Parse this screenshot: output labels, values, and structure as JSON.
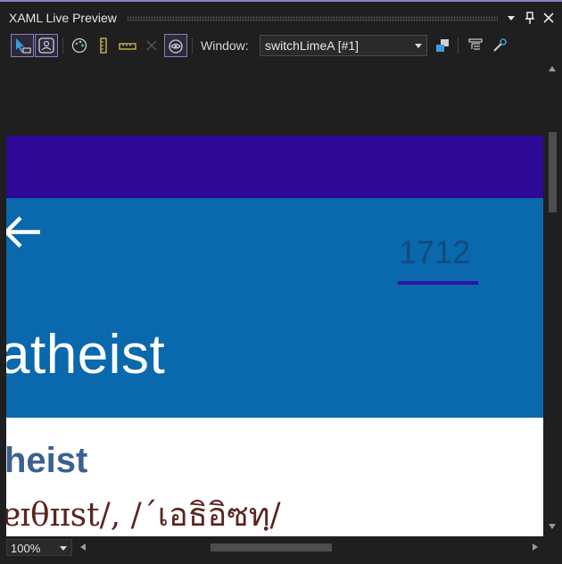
{
  "panel": {
    "title": "XAML Live Preview",
    "menu_icon": "dropdown-arrow-icon",
    "pin_icon": "pin-icon",
    "close_icon": "close-icon",
    "accent_color": "#8e7cc3"
  },
  "toolbar": {
    "tools": [
      {
        "name": "select-element-icon",
        "active": true
      },
      {
        "name": "display-layout-adorners-icon",
        "active": true
      },
      {
        "name": "color-contrast-icon",
        "active": false
      },
      {
        "name": "ruler-icon",
        "active": false
      },
      {
        "name": "horizontal-ruler-icon",
        "active": false
      },
      {
        "name": "clear-icon",
        "active": false
      },
      {
        "name": "preview-eye-icon",
        "active": true
      }
    ],
    "window_label": "Window:",
    "window_value": "switchLimeA [#1]",
    "right_tools": [
      "detach-window-icon",
      "live-visual-tree-icon",
      "settings-wrench-icon"
    ]
  },
  "app": {
    "header_color": "#2e0a97",
    "content_color": "#0a68ad",
    "back_icon": "back-arrow-icon",
    "count": "1712",
    "title_word": "atheist",
    "word": "heist",
    "phonetic": "ɐɪθɪɪst/, /ˊเอธิอิซทฺ/"
  },
  "status": {
    "zoom": "100%"
  }
}
